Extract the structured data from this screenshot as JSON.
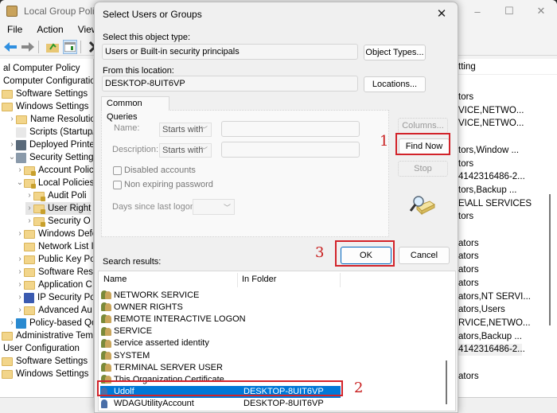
{
  "mmc": {
    "title": "Local Group Policy",
    "window_controls": [
      "–",
      "☐",
      "✕"
    ],
    "menu": [
      "File",
      "Action",
      "View"
    ],
    "toolbar_icons": [
      "back-arrow-icon",
      "forward-arrow-icon",
      "up-folder-icon",
      "show-hide-tree-icon",
      "delete-icon"
    ],
    "tree": [
      {
        "label": "al Computer Policy",
        "level": 0,
        "chevron": "",
        "icon": "none"
      },
      {
        "label": "Computer Configuration",
        "level": 0,
        "chevron": "",
        "icon": "none"
      },
      {
        "label": "Software Settings",
        "level": 1,
        "chevron": "",
        "icon": "folder"
      },
      {
        "label": "Windows Settings",
        "level": 1,
        "chevron": "",
        "icon": "folder"
      },
      {
        "label": "Name Resolution",
        "level": 2,
        "chevron": ">",
        "icon": "folder"
      },
      {
        "label": "Scripts (Startup/S",
        "level": 2,
        "chevron": "",
        "icon": "script"
      },
      {
        "label": "Deployed Printers",
        "level": 2,
        "chevron": ">",
        "icon": "printer"
      },
      {
        "label": "Security Settings",
        "level": 2,
        "chevron": "v",
        "icon": "security"
      },
      {
        "label": "Account Polic",
        "level": 3,
        "chevron": ">",
        "icon": "lockfolder"
      },
      {
        "label": "Local Policies",
        "level": 3,
        "chevron": "v",
        "icon": "lockfolder"
      },
      {
        "label": "Audit Poli",
        "level": 4,
        "chevron": ">",
        "icon": "lockfolder"
      },
      {
        "label": "User Right",
        "level": 4,
        "chevron": ">",
        "icon": "lockfolder",
        "selected": true
      },
      {
        "label": "Security O",
        "level": 4,
        "chevron": ">",
        "icon": "lockfolder"
      },
      {
        "label": "Windows Defe",
        "level": 3,
        "chevron": ">",
        "icon": "folder"
      },
      {
        "label": "Network List I",
        "level": 3,
        "chevron": "",
        "icon": "folder"
      },
      {
        "label": "Public Key Po",
        "level": 3,
        "chevron": ">",
        "icon": "folder"
      },
      {
        "label": "Software Rest",
        "level": 3,
        "chevron": ">",
        "icon": "folder"
      },
      {
        "label": "Application C",
        "level": 3,
        "chevron": ">",
        "icon": "folder"
      },
      {
        "label": "IP Security Po",
        "level": 3,
        "chevron": ">",
        "icon": "ipsec"
      },
      {
        "label": "Advanced Au",
        "level": 3,
        "chevron": ">",
        "icon": "folder"
      },
      {
        "label": "Policy-based QoS",
        "level": 2,
        "chevron": ">",
        "icon": "chart"
      },
      {
        "label": "Administrative Temp",
        "level": 1,
        "chevron": "",
        "icon": "folder"
      },
      {
        "label": "User Configuration",
        "level": 0,
        "chevron": "",
        "icon": "none"
      },
      {
        "label": "Software Settings",
        "level": 1,
        "chevron": "",
        "icon": "folder"
      },
      {
        "label": "Windows Settings",
        "level": 1,
        "chevron": "",
        "icon": "folder"
      }
    ],
    "right_pane": {
      "header": "tting",
      "rows": [
        "tors",
        "VICE,NETWO...",
        "VICE,NETWO...",
        "",
        "tors,Window ...",
        "tors",
        "4142316486-2...",
        "tors,Backup ...",
        "E\\ALL SERVICES",
        "tors",
        "",
        "ators",
        "ators",
        "ators",
        "ators",
        "ators,NT SERVI...",
        "ators,Users",
        "RVICE,NETWO...",
        "ators,Backup ...",
        "4142316486-2...",
        "",
        "ators"
      ]
    }
  },
  "dialog": {
    "title": "Select Users or Groups",
    "close_glyph": "✕",
    "object_type_label": "Select this object type:",
    "object_type_value": "Users or Built-in security principals",
    "object_types_button": "Object Types...",
    "location_label": "From this location:",
    "location_value": "DESKTOP-8UIT6VP",
    "locations_button": "Locations...",
    "tab_label": "Common Queries",
    "name_label": "Name:",
    "name_mode": "Starts with",
    "description_label": "Description:",
    "description_mode": "Starts with",
    "disabled_accounts_label": "Disabled accounts",
    "non_expiring_label": "Non expiring password",
    "days_since_label": "Days since last logon:",
    "columns_button": "Columns...",
    "find_now_button": "Find Now",
    "stop_button": "Stop",
    "ok_button": "OK",
    "cancel_button": "Cancel",
    "search_results_label": "Search results:",
    "columns": [
      "Name",
      "In Folder"
    ],
    "results": [
      {
        "name": "NETWORK SERVICE",
        "folder": "",
        "icon": "group"
      },
      {
        "name": "OWNER RIGHTS",
        "folder": "",
        "icon": "group"
      },
      {
        "name": "REMOTE INTERACTIVE LOGON",
        "folder": "",
        "icon": "group"
      },
      {
        "name": "SERVICE",
        "folder": "",
        "icon": "group"
      },
      {
        "name": "Service asserted identity",
        "folder": "",
        "icon": "group"
      },
      {
        "name": "SYSTEM",
        "folder": "",
        "icon": "group"
      },
      {
        "name": "TERMINAL SERVER USER",
        "folder": "",
        "icon": "group"
      },
      {
        "name": "This Organization Certificate",
        "folder": "",
        "icon": "group"
      },
      {
        "name": "Udolf",
        "folder": "DESKTOP-8UIT6VP",
        "icon": "user",
        "selected": true
      },
      {
        "name": "WDAGUtilityAccount",
        "folder": "DESKTOP-8UIT6VP",
        "icon": "user-disabled"
      }
    ]
  },
  "annotations": {
    "step1": "1",
    "step2": "2",
    "step3": "3",
    "highlight_color": "#d2232a"
  },
  "colors": {
    "selection": "#0078d7",
    "default_button_border": "#0067c0"
  }
}
